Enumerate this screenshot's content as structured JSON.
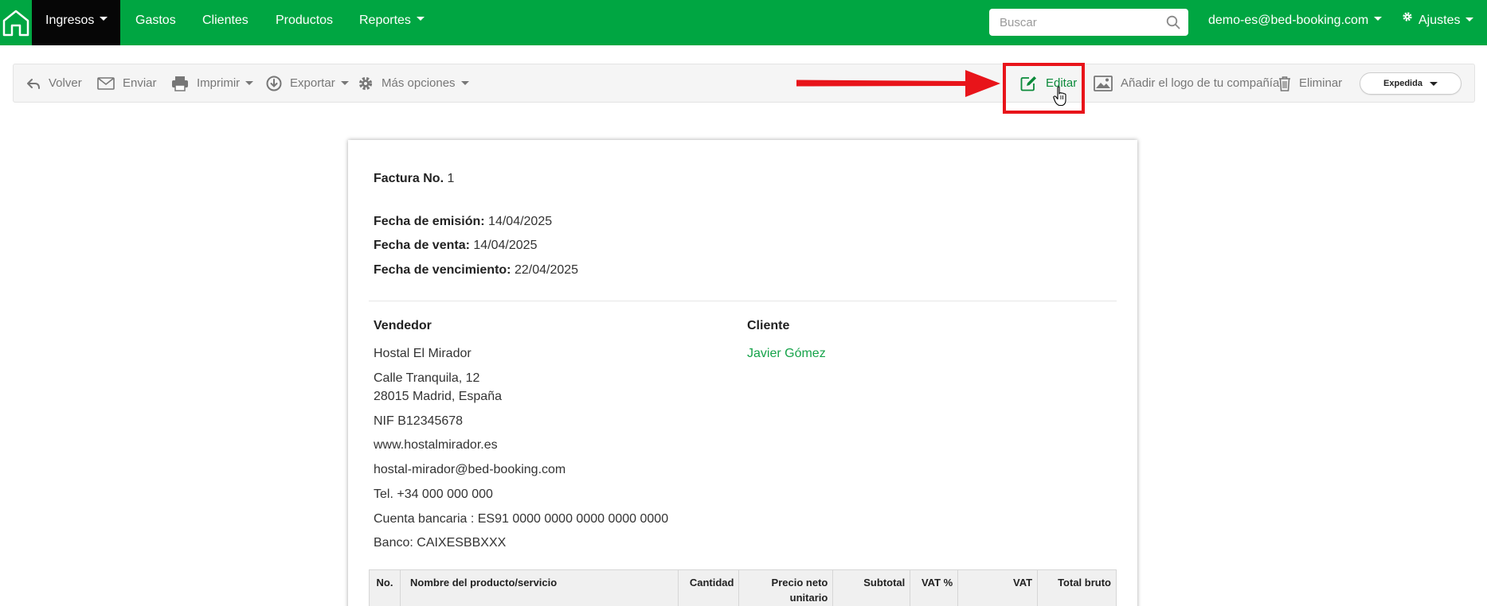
{
  "nav": {
    "items": [
      {
        "label": "Ingresos"
      },
      {
        "label": "Gastos"
      },
      {
        "label": "Clientes"
      },
      {
        "label": "Productos"
      },
      {
        "label": "Reportes"
      }
    ],
    "search_placeholder": "Buscar",
    "user_email": "demo-es@bed-booking.com",
    "settings_label": "Ajustes",
    "brand_color": "#00a642"
  },
  "toolbar": {
    "back": "Volver",
    "send": "Enviar",
    "print": "Imprimir",
    "export": "Exportar",
    "more": "Más opciones",
    "edit": "Editar",
    "add_logo": "Añadir el logo de tu compañía",
    "delete": "Eliminar",
    "status": "Expedida"
  },
  "annotation": {
    "color": "#e8141a"
  },
  "invoice": {
    "number_label": "Factura No.",
    "number": "1",
    "issue_label": "Fecha de emisión:",
    "issue_date": "14/04/2025",
    "sale_label": "Fecha de venta:",
    "sale_date": "14/04/2025",
    "due_label": "Fecha de vencimiento:",
    "due_date": "22/04/2025",
    "seller": {
      "heading": "Vendedor",
      "name": "Hostal El Mirador",
      "street": "Calle Tranquila, 12",
      "city": "28015 Madrid, España",
      "nif": "NIF B12345678",
      "website": "www.hostalmirador.es",
      "email": "hostal-mirador@bed-booking.com",
      "phone": "Tel. +34 000 000 000",
      "bank_account": "Cuenta bancaria : ES91 0000 0000 0000 0000 0000",
      "bank": "Banco: CAIXESBBXXX"
    },
    "client": {
      "heading": "Cliente",
      "name": "Javier Gómez"
    },
    "table_headers": {
      "no": "No.",
      "name": "Nombre del producto/servicio",
      "qty": "Cantidad",
      "unit_price": "Precio neto unitario",
      "subtotal": "Subtotal",
      "vat_rate": "VAT %",
      "vat": "VAT",
      "gross": "Total bruto"
    }
  }
}
